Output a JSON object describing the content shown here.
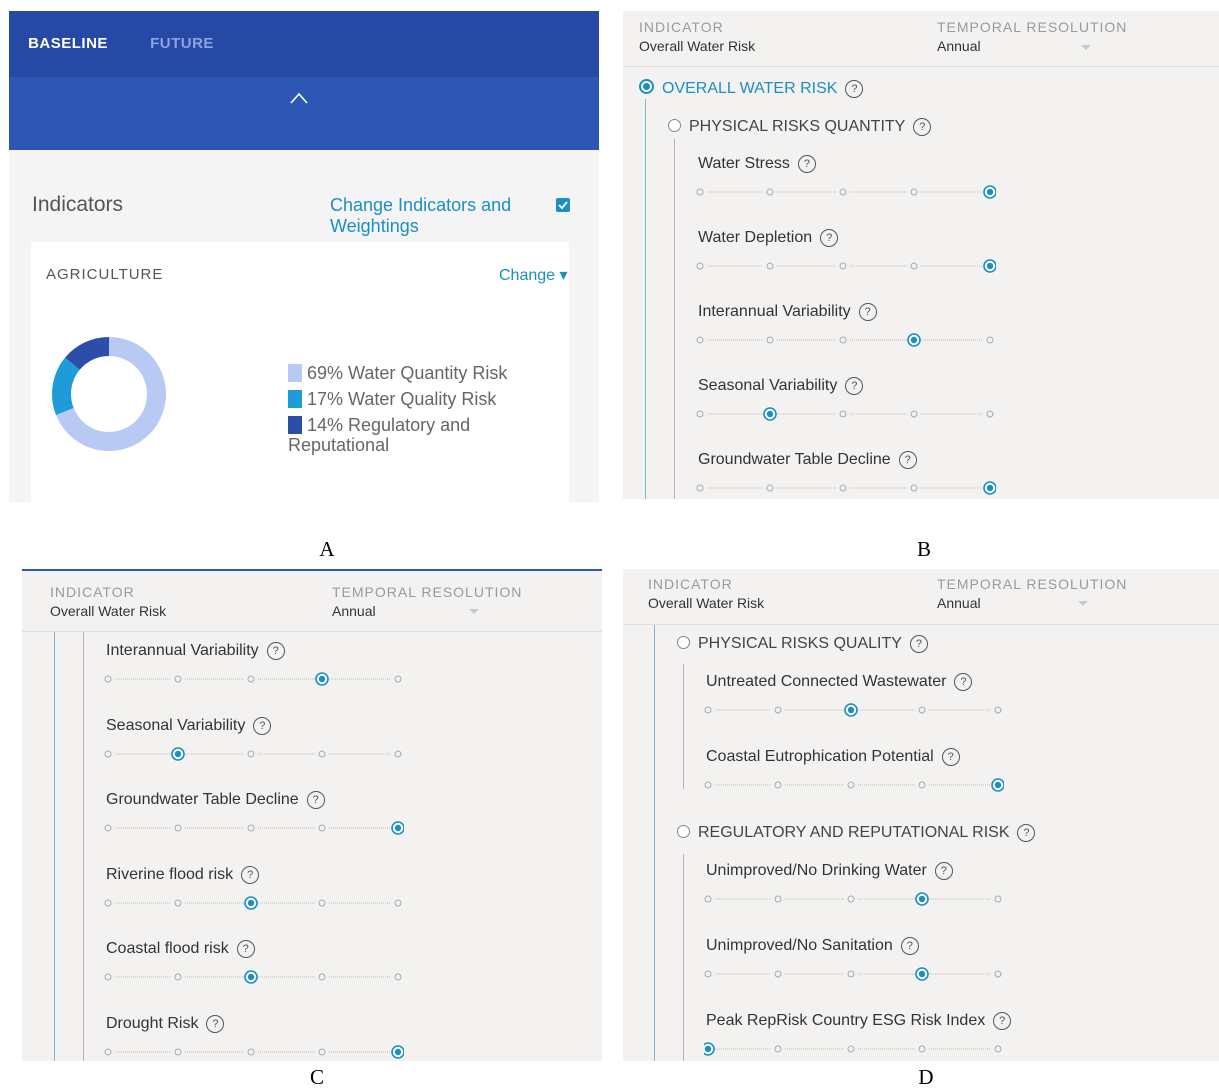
{
  "captions": {
    "a": "A",
    "b": "B",
    "c": "C",
    "d": "D"
  },
  "panel_a": {
    "tabs": {
      "baseline": "BASELINE",
      "future": "FUTURE"
    },
    "indicators_title": "Indicators",
    "change_link": "Change Indicators and Weightings",
    "card": {
      "title": "AGRICULTURE",
      "change": "Change ▾",
      "legend": [
        {
          "label": "69% Water Quantity Risk",
          "percent": 69,
          "color": "#b8c9f4"
        },
        {
          "label": "17% Water Quality Risk",
          "percent": 17,
          "color": "#1e9bd8"
        },
        {
          "label": "14% Regulatory and Reputational",
          "percent": 14,
          "color": "#2b4fa8"
        }
      ]
    }
  },
  "header": {
    "indicator_label": "INDICATOR",
    "indicator_value": "Overall Water Risk",
    "temporal_label": "TEMPORAL RESOLUTION",
    "temporal_value": "Annual"
  },
  "panel_b": {
    "overall": "OVERALL WATER RISK",
    "section": "PHYSICAL RISKS QUANTITY",
    "items": [
      {
        "label": "Water Stress",
        "level": 5
      },
      {
        "label": "Water Depletion",
        "level": 5
      },
      {
        "label": "Interannual Variability",
        "level": 4
      },
      {
        "label": "Seasonal Variability",
        "level": 2
      },
      {
        "label": "Groundwater Table Decline",
        "level": 5
      }
    ]
  },
  "panel_c": {
    "items": [
      {
        "label": "Interannual Variability",
        "level": 4
      },
      {
        "label": "Seasonal Variability",
        "level": 2
      },
      {
        "label": "Groundwater Table Decline",
        "level": 5
      },
      {
        "label": "Riverine flood risk",
        "level": 3
      },
      {
        "label": "Coastal flood risk",
        "level": 3
      },
      {
        "label": "Drought Risk",
        "level": 5
      }
    ]
  },
  "panel_d": {
    "section_quality": "PHYSICAL RISKS QUALITY",
    "quality_items": [
      {
        "label": "Untreated Connected Wastewater",
        "level": 3
      },
      {
        "label": "Coastal Eutrophication Potential",
        "level": 5
      }
    ],
    "section_regulatory": "REGULATORY AND REPUTATIONAL RISK",
    "regulatory_items": [
      {
        "label": "Unimproved/No Drinking Water",
        "level": 4
      },
      {
        "label": "Unimproved/No Sanitation",
        "level": 4
      },
      {
        "label": "Peak RepRisk Country ESG Risk Index",
        "level": 1
      }
    ]
  },
  "help_glyph": "?",
  "colors": {
    "accent": "#1a8fc0",
    "topbar": "#2e57b5"
  }
}
